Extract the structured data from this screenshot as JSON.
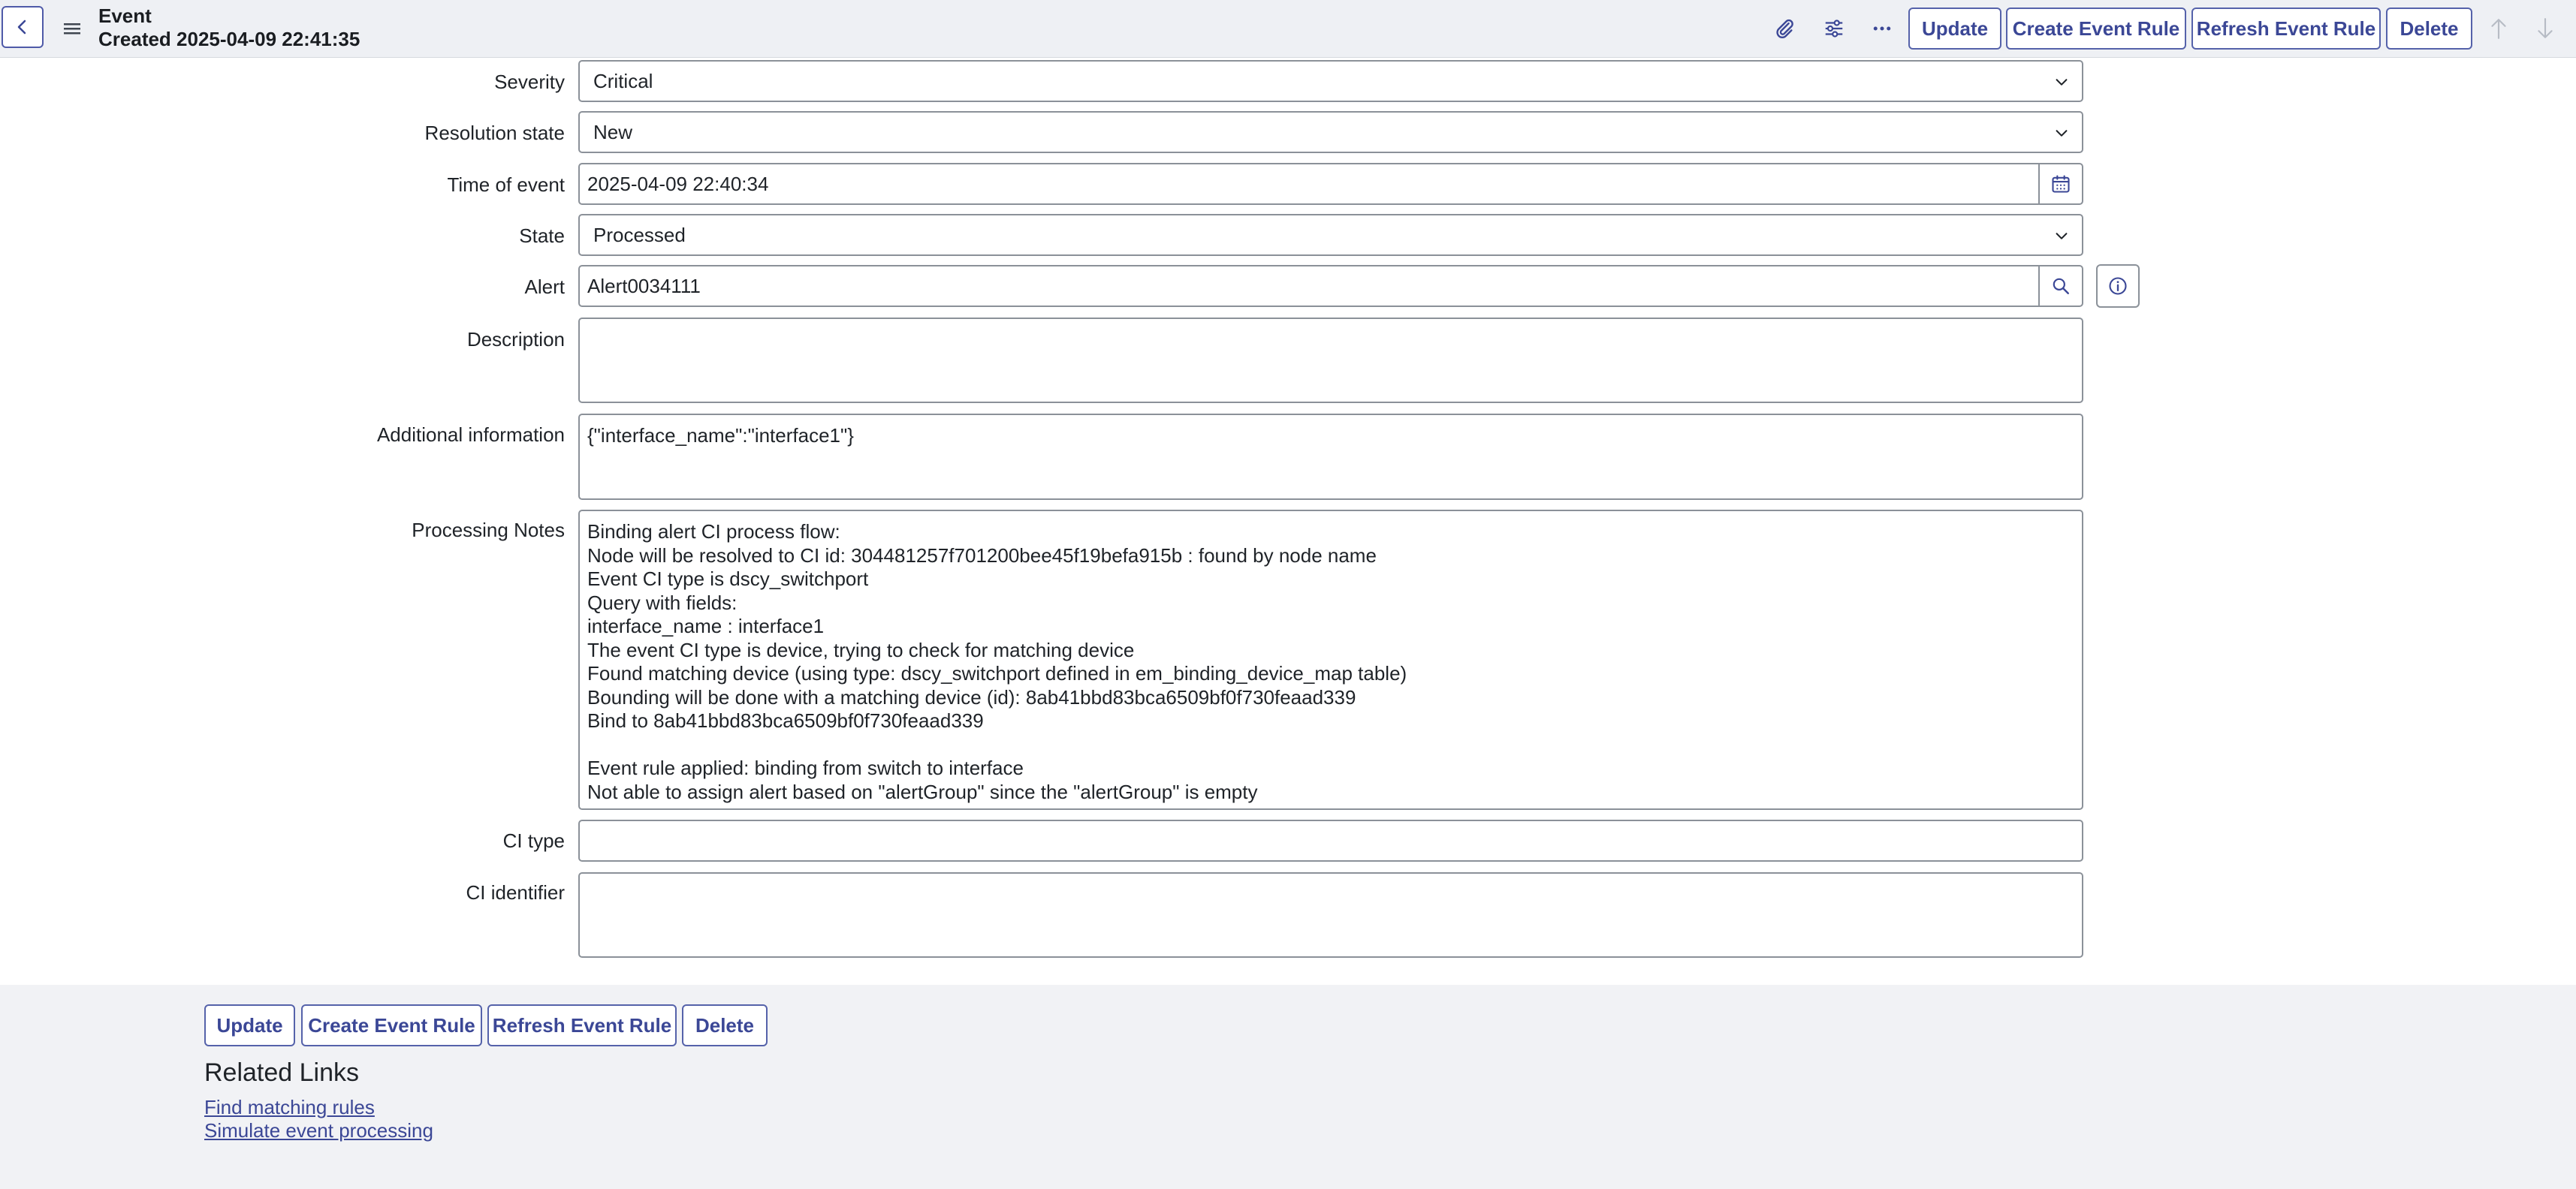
{
  "header": {
    "title": "Event",
    "subtitle": "Created 2025-04-09 22:41:35",
    "icons": {
      "back": "chevron-left-icon",
      "menu": "hamburger-icon",
      "attach": "paperclip-icon",
      "personalize": "sliders-icon",
      "more": "ellipsis-icon",
      "prev": "arrow-up-icon",
      "next": "arrow-down-icon"
    },
    "buttons": {
      "update": "Update",
      "create_rule": "Create Event Rule",
      "refresh_rule": "Refresh Event Rule",
      "delete": "Delete"
    }
  },
  "form": {
    "severity": {
      "label": "Severity",
      "value": "Critical"
    },
    "resolution_state": {
      "label": "Resolution state",
      "value": "New"
    },
    "time_of_event": {
      "label": "Time of event",
      "value": "2025-04-09 22:40:34"
    },
    "state": {
      "label": "State",
      "value": "Processed"
    },
    "alert": {
      "label": "Alert",
      "value": "Alert0034111"
    },
    "description": {
      "label": "Description",
      "value": ""
    },
    "additional_info": {
      "label": "Additional information",
      "value": "{\"interface_name\":\"interface1\"}"
    },
    "processing_notes": {
      "label": "Processing Notes",
      "value": "Binding alert CI process flow:\nNode will be resolved to CI id: 304481257f701200bee45f19befa915b : found by node name\nEvent CI type is dscy_switchport\nQuery with fields:\ninterface_name : interface1\nThe event CI type is device, trying to check for matching device\nFound matching device (using type: dscy_switchport defined in em_binding_device_map table)\nBounding will be done with a matching device (id): 8ab41bbd83bca6509bf0f730feaad339\nBind to 8ab41bbd83bca6509bf0f730feaad339\n\nEvent rule applied: binding from switch to interface\nNot able to assign alert based on \"alertGroup\" since the \"alertGroup\" is empty"
    },
    "ci_type": {
      "label": "CI type",
      "value": ""
    },
    "ci_identifier": {
      "label": "CI identifier",
      "value": ""
    }
  },
  "footer": {
    "buttons": {
      "update": "Update",
      "create_rule": "Create Event Rule",
      "refresh_rule": "Refresh Event Rule",
      "delete": "Delete"
    },
    "related_title": "Related Links",
    "links": [
      "Find matching rules",
      "Simulate event processing"
    ]
  },
  "colors": {
    "accent": "#3b4796",
    "header_bg": "#eef0f4",
    "footer_bg": "#f1f2f5",
    "field_border": "#8b9199"
  }
}
